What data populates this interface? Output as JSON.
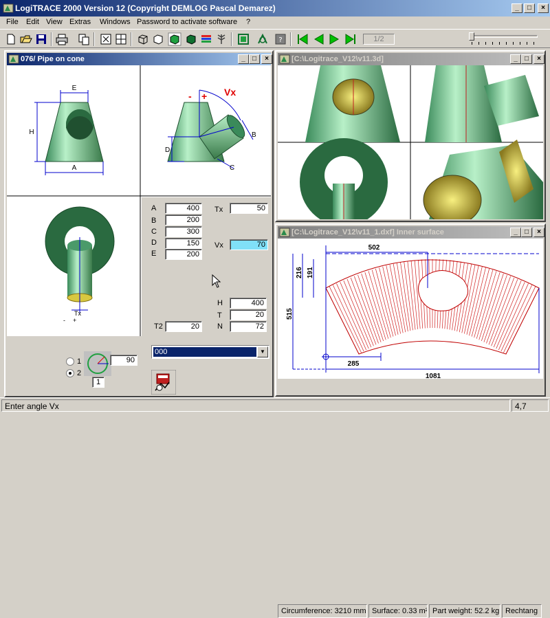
{
  "app": {
    "title": "LogiTRACE 2000  Version 12  (Copyright DEMLOG Pascal Demarez)"
  },
  "menu": [
    "File",
    "Edit",
    "View",
    "Extras",
    "Windows",
    "Password to activate software",
    "?"
  ],
  "toolbar": {
    "page_indicator": "1/2",
    "icons": [
      "new-icon",
      "open-icon",
      "save-icon",
      "print-icon",
      "copy-icon",
      "single-view-icon",
      "quad-view-icon",
      "wireframe-icon",
      "hidden-lines-icon",
      "shaded-icon",
      "shaded-dark-icon",
      "color-layers-icon",
      "tree-icon",
      "unfold-icon",
      "shape-icon",
      "template-icon",
      "first-icon",
      "previous-icon",
      "next-icon",
      "last-icon"
    ]
  },
  "windows": {
    "left": {
      "title": "076/ Pipe on cone",
      "labels": {
        "dim_e": "E",
        "dim_h": "H",
        "dim_a": "A",
        "dim_d": "D",
        "dim_c": "C",
        "dim_b": "B",
        "angle_vx": "Vx",
        "minus": "-",
        "plus": "+",
        "tx": "Tx",
        "minus2": "-",
        "plus2": "+"
      },
      "params": [
        {
          "label": "A",
          "value": "400"
        },
        {
          "label": "B",
          "value": "200"
        },
        {
          "label": "C",
          "value": "300"
        },
        {
          "label": "D",
          "value": "150"
        },
        {
          "label": "E",
          "value": "200"
        }
      ],
      "tx": {
        "label": "Tx",
        "value": "50"
      },
      "vx": {
        "label": "Vx",
        "value": "70"
      },
      "h": {
        "label": "H",
        "value": "400"
      },
      "t": {
        "label": "T",
        "value": "20"
      },
      "n": {
        "label": "N",
        "value": "72"
      },
      "t2": {
        "label": "T2",
        "value": "20"
      },
      "combo_value": "000",
      "radio1_label": "1",
      "radio2_label": "2",
      "angle_value": "90",
      "small_value": "1"
    },
    "view3d": {
      "title": "[C:\\Logitrace_V12\\v11.3d]"
    },
    "dxf": {
      "title": "[C:\\Logitrace_V12\\v11_1.dxf]  Inner surface",
      "dims": {
        "top": "502",
        "left_outer": "216",
        "left_inner": "191",
        "height": "515",
        "bottom_inner": "285",
        "bottom": "1081"
      },
      "status": {
        "circumference": "Circumference: 3210 mm",
        "surface": "Surface: 0.33 m²",
        "weight": "Part weight: 52.2 kg",
        "rect": "Rechtang"
      }
    }
  },
  "status": {
    "message": "Enter angle Vx",
    "coord": "4,7"
  },
  "colors": {
    "pipe_green": "#88d8a8",
    "dim_blue": "#0000cc",
    "angle_red": "#e00000",
    "vx_highlight": "#80e0f8",
    "title_active": "#0a246a"
  }
}
